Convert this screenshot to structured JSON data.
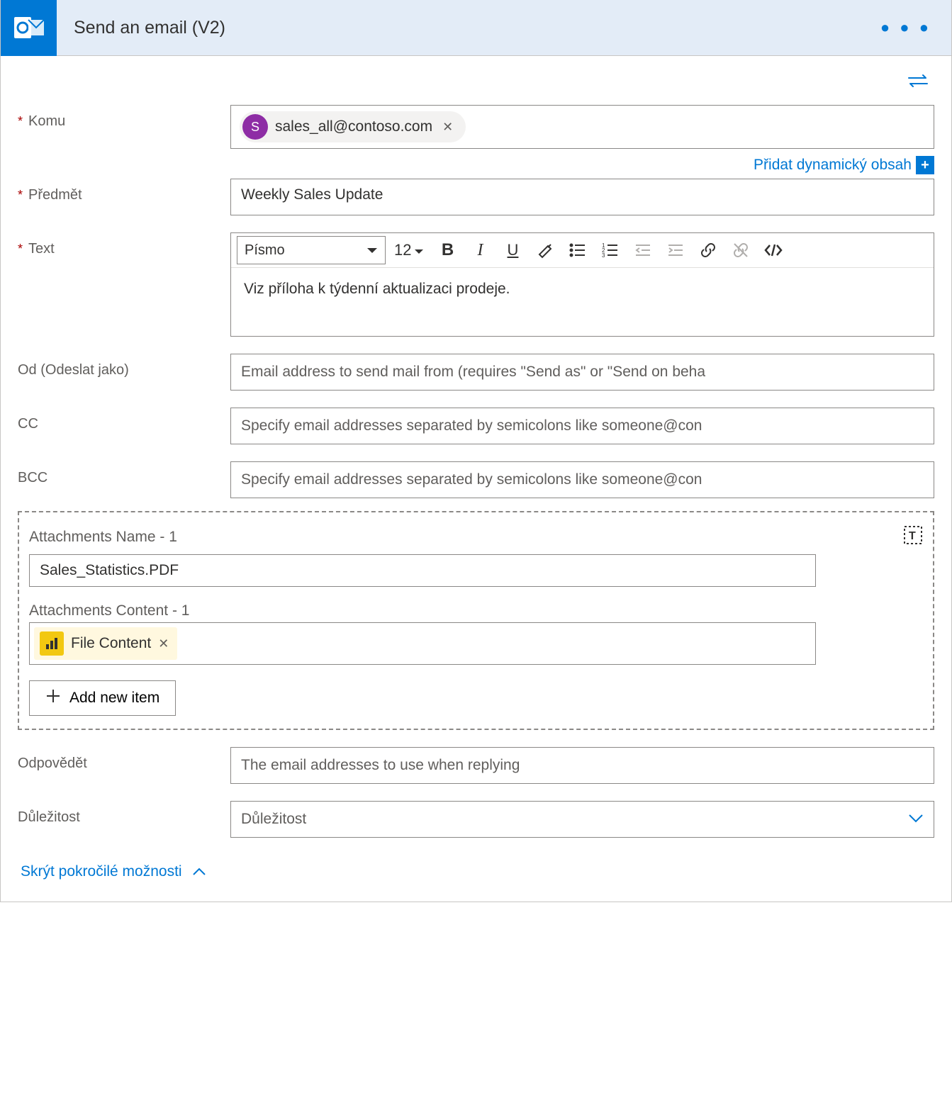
{
  "header": {
    "title": "Send an email (V2)"
  },
  "fields": {
    "to": {
      "label": "Komu",
      "chip_initial": "S",
      "chip_email": "sales_all@contoso.com",
      "dynamic_link": "Přidat dynamický obsah"
    },
    "subject": {
      "label": "Předmět",
      "value": "Weekly Sales Update"
    },
    "body": {
      "label": "Text",
      "font_label": "Písmo",
      "font_size": "12",
      "content": "Viz příloha k týdenní aktualizaci prodeje."
    },
    "from": {
      "label": "Od (Odeslat jako)",
      "placeholder": "Email address to send mail from (requires \"Send as\" or \"Send on beha"
    },
    "cc": {
      "label": "CC",
      "placeholder": "Specify email addresses separated by semicolons like someone@con"
    },
    "bcc": {
      "label": "BCC",
      "placeholder": "Specify email addresses separated by semicolons like someone@con"
    },
    "attachments": {
      "name_label": "Attachments Name - 1",
      "name_value": "Sales_Statistics.PDF",
      "content_label": "Attachments Content - 1",
      "token_label": "File Content",
      "add_item": "Add new item"
    },
    "reply": {
      "label": "Odpovědět",
      "placeholder": "The email addresses to use when replying"
    },
    "importance": {
      "label": "Důležitost",
      "placeholder": "Důležitost"
    }
  },
  "footer": {
    "hide_advanced": "Skrýt pokročilé možnosti"
  }
}
